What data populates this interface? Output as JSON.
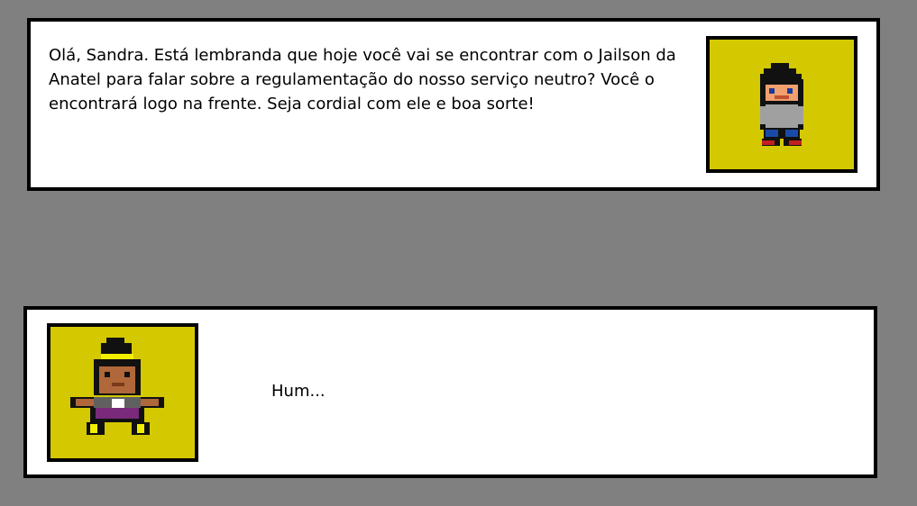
{
  "dialogs": [
    {
      "speaker_icon": "boy-character-portrait",
      "text": "Olá, Sandra. Está lembranda que hoje você vai se encontrar com o Jailson da\nAnatel para falar sobre a regulamentação do nosso serviço neutro? Você o\nencontrará logo na frente. Seja cordial com ele e boa sorte!"
    },
    {
      "speaker_icon": "woman-character-portrait",
      "text": "Hum..."
    }
  ],
  "colors": {
    "background": "#808080",
    "panel": "#ffffff",
    "border": "#000000",
    "portrait_bg": "#d4c800"
  }
}
